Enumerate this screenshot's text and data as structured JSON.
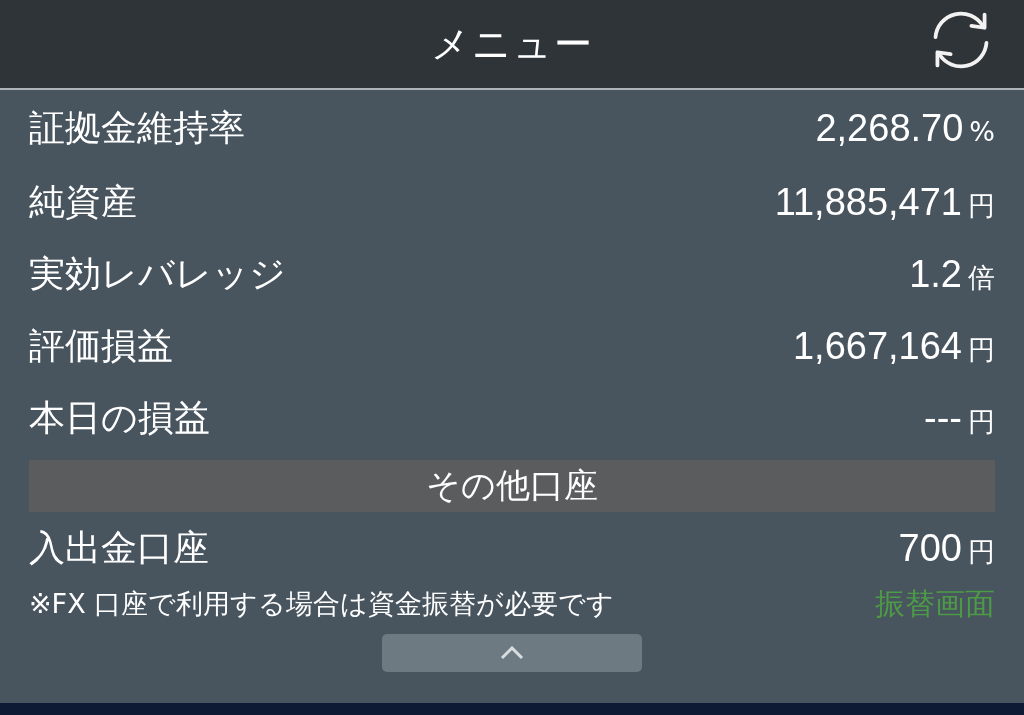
{
  "header": {
    "title": "メニュー"
  },
  "rows": [
    {
      "label": "証拠金維持率",
      "value": "2,268.70",
      "unit": "%"
    },
    {
      "label": "純資産",
      "value": "11,885,471",
      "unit": "円"
    },
    {
      "label": "実効レバレッジ",
      "value": "1.2",
      "unit": "倍"
    },
    {
      "label": "評価損益",
      "value": "1,667,164",
      "unit": "円"
    },
    {
      "label": "本日の損益",
      "value": "---",
      "unit": "円"
    }
  ],
  "section": {
    "title": "その他口座"
  },
  "other_rows": [
    {
      "label": "入出金口座",
      "value": "700",
      "unit": "円"
    }
  ],
  "note": {
    "text": "※FX 口座で利用する場合は資金振替が必要です",
    "link": "振替画面"
  }
}
